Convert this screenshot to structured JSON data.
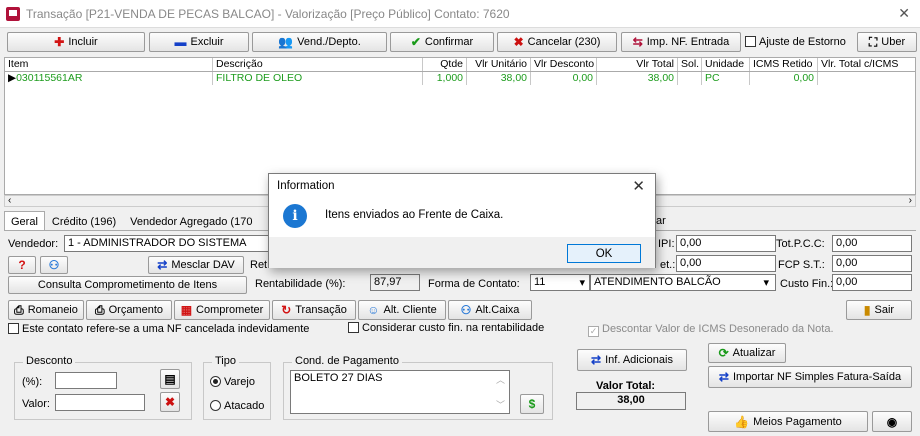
{
  "window": {
    "title": "Transação [P21-VENDA DE PECAS BALCAO] - Valorização [Preço Público]  Contato: 7620",
    "close": "✕"
  },
  "toolbar": {
    "incluir": "Incluir",
    "excluir": "Excluir",
    "vend_depto": "Vend./Depto.",
    "confirmar": "Confirmar",
    "cancelar": "Cancelar (230)",
    "imp_nf": "Imp. NF. Entrada",
    "ajuste": "Ajuste de Estorno",
    "uber": "Uber"
  },
  "grid": {
    "columns": [
      "Item",
      "Descrição",
      "Qtde",
      "Vlr Unitário",
      "Vlr Desconto",
      "Vlr Total",
      "Sol.",
      "Unidade",
      "ICMS Retido",
      "Vlr. Total c/ICMS"
    ],
    "rows": [
      {
        "item": "030115561AR",
        "desc": "FILTRO DE OLEO",
        "qtde": "1,000",
        "unit": "38,00",
        "desc_val": "0,00",
        "total": "38,00",
        "sol": "",
        "unidade": "PC",
        "icms": "0,00",
        "total_icms": ""
      }
    ]
  },
  "tabs": [
    "Geral",
    "Crédito (196)",
    "Vendedor Agregado (170",
    "ar"
  ],
  "geral": {
    "vendedor_label": "Vendedor:",
    "vendedor_value": "1 - ADMINISTRADOR DO SISTEMA",
    "mesclar": "Mesclar DAV",
    "ret": "Ret",
    "consulta": "Consulta Comprometimento de Itens",
    "rent_label": "Rentabilidade (%):",
    "rent_value": "87,97",
    "forma_label": "Forma de Contato:",
    "forma_code": "11",
    "forma_value": "ATENDIMENTO BALCÃO",
    "ipi_label": "IPI:",
    "ipi_value": "0,00",
    "et_label": "et.:",
    "et_value": "0,00",
    "totpcc_label": "Tot.P.C.C:",
    "totpcc_value": "0,00",
    "fcp_label": "FCP S.T.:",
    "fcp_value": "0,00",
    "custo_label": "Custo Fin.:",
    "custo_value": "0,00"
  },
  "actions": {
    "romaneio": "Romaneio",
    "orcamento": "Orçamento",
    "comprometer": "Comprometer",
    "transacao": "Transação",
    "alt_cliente": "Alt. Cliente",
    "alt_caixa": "Alt.Caixa",
    "sair": "Sair"
  },
  "checks": {
    "nf_cancelada": "Este contato refere-se a uma NF cancelada indevidamente",
    "custo_fin": "Considerar custo fin. na rentabilidade",
    "icms_deson": "Descontar Valor de ICMS Desonerado da Nota."
  },
  "desconto": {
    "title": "Desconto",
    "pct_label": "(%):",
    "valor_label": "Valor:"
  },
  "tipo": {
    "title": "Tipo",
    "varejo": "Varejo",
    "atacado": "Atacado"
  },
  "cond": {
    "title": "Cond. de Pagamento",
    "value": "BOLETO 27 DIAS"
  },
  "right": {
    "inf_adicionais": "Inf. Adicionais",
    "atualizar": "Atualizar",
    "importar": "Importar NF Simples Fatura-Saída",
    "valor_total_label": "Valor Total:",
    "valor_total": "38,00",
    "meios": "Meios Pagamento"
  },
  "dialog": {
    "title": "Information",
    "message": "Itens enviados ao Frente de Caixa.",
    "ok": "OK",
    "close": "✕"
  }
}
